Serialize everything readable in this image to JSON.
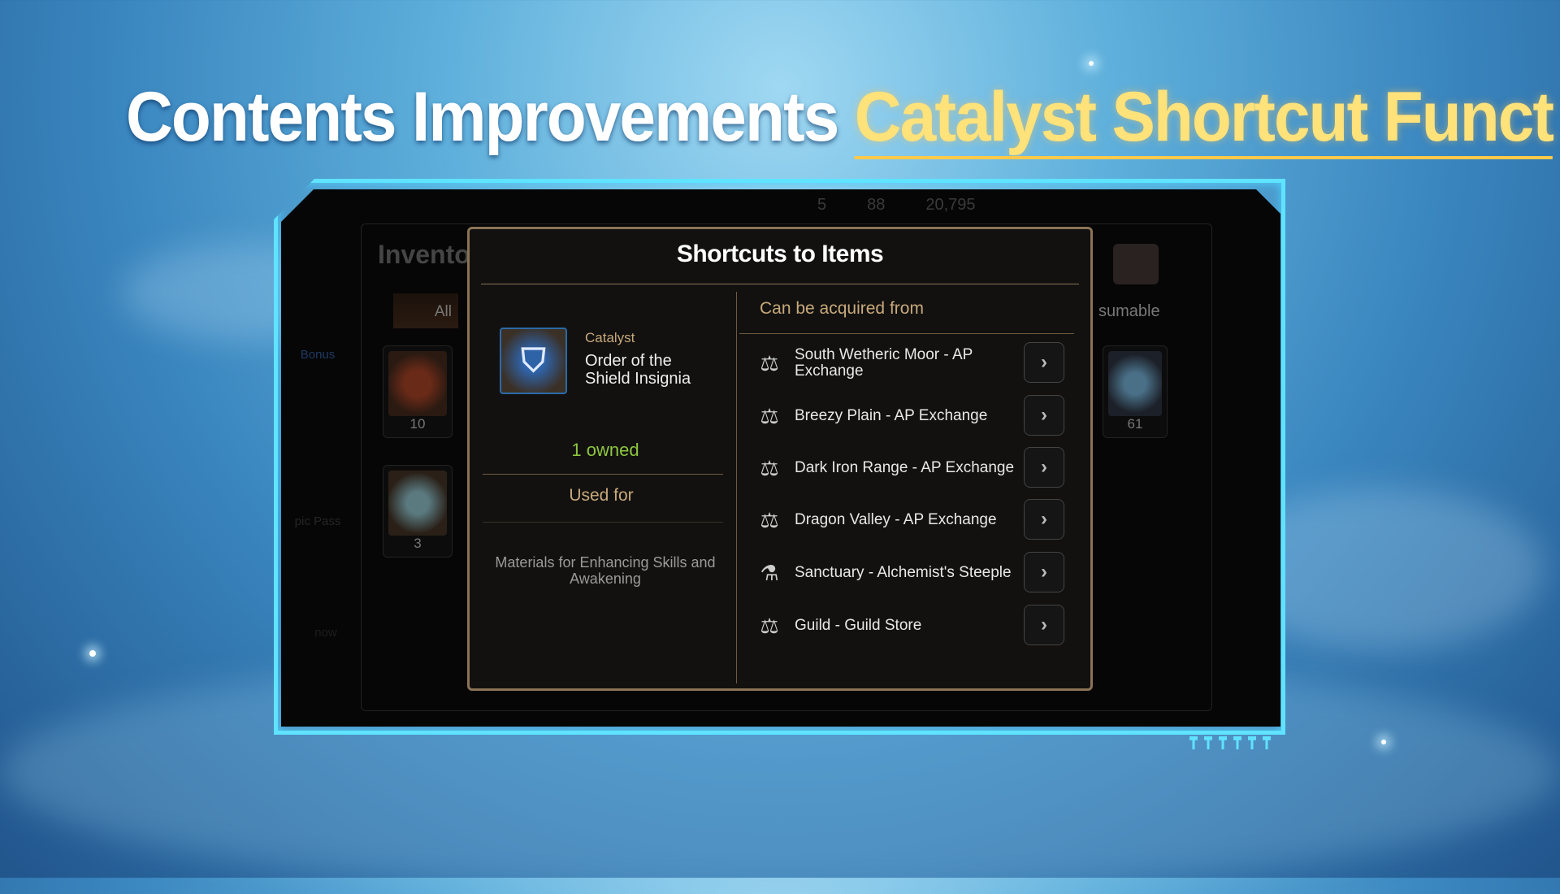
{
  "banner": {
    "title_white": "Contents Improvements",
    "title_yellow": "Catalyst Shortcut Funct"
  },
  "status_bar": {
    "value1": "5",
    "value2": "88",
    "value3": "20,795"
  },
  "sidebar": {
    "items": [
      "Bonus",
      "pic Pass",
      "now"
    ]
  },
  "inventory": {
    "title": "Invento",
    "tab_all": "All",
    "items": [
      {
        "count": "10"
      },
      {
        "count": "3"
      }
    ],
    "right_tab": "sumable",
    "right_items": [
      {
        "count": "61"
      }
    ]
  },
  "dialog": {
    "title": "Shortcuts to Items",
    "item": {
      "category": "Catalyst",
      "name": "Order of the Shield Insignia",
      "owned": "1 owned",
      "used_for_label": "Used for",
      "used_for": "Materials for Enhancing Skills and Awakening"
    },
    "sources_label": "Can be acquired from",
    "sources": [
      {
        "label": "South Wetheric Moor - AP Exchange",
        "icon": "scales-icon"
      },
      {
        "label": "Breezy Plain - AP Exchange",
        "icon": "scales-icon"
      },
      {
        "label": "Dark Iron Range - AP Exchange",
        "icon": "scales-icon"
      },
      {
        "label": "Dragon Valley - AP Exchange",
        "icon": "scales-icon"
      },
      {
        "label": "Sanctuary - Alchemist's Steeple",
        "icon": "flask-icon"
      },
      {
        "label": "Guild - Guild Store",
        "icon": "guild-store-icon"
      }
    ],
    "go_glyph": "›"
  },
  "colors": {
    "accent_frame": "#5fe3ff",
    "title_yellow": "#ffe27a",
    "gold": "#c8a97a",
    "owned_green": "#8dc63f"
  }
}
